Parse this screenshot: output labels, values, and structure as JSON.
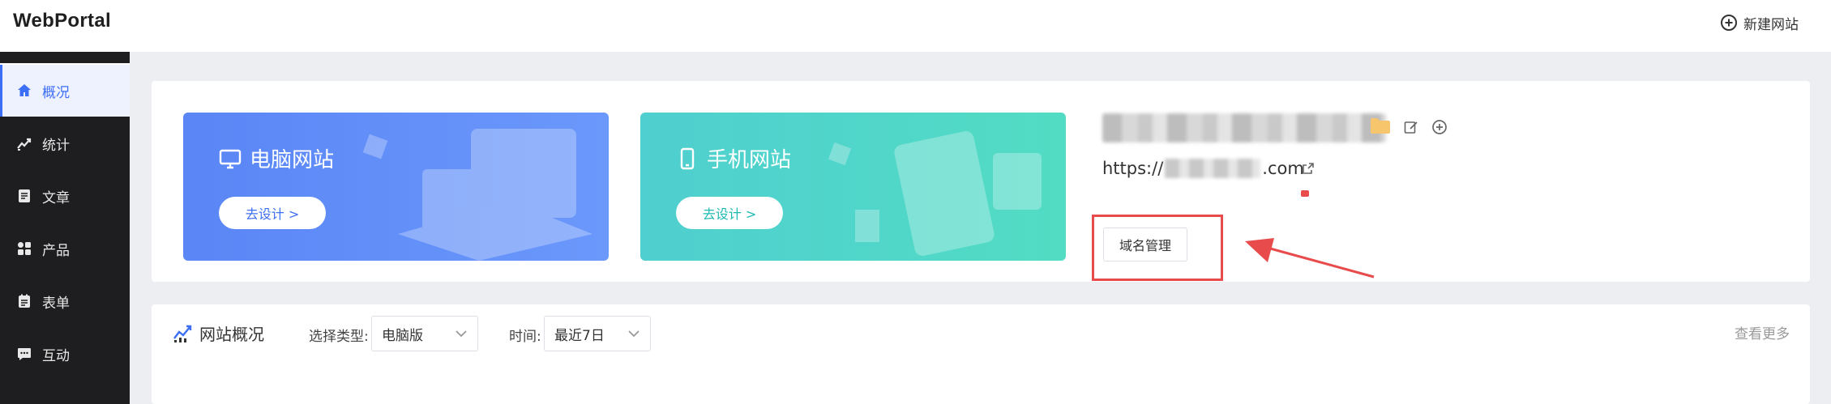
{
  "header": {
    "logo": "WebPortal",
    "new_site_label": "新建网站"
  },
  "sidebar": {
    "items": [
      {
        "label": "概况",
        "icon": "home-icon",
        "active": true
      },
      {
        "label": "统计",
        "icon": "chart-line-icon"
      },
      {
        "label": "文章",
        "icon": "article-icon"
      },
      {
        "label": "产品",
        "icon": "grid-icon"
      },
      {
        "label": "表单",
        "icon": "form-icon"
      },
      {
        "label": "互动",
        "icon": "chat-icon"
      }
    ]
  },
  "cards": {
    "pc": {
      "title": "电脑网站",
      "button": "去设计 >"
    },
    "mobile": {
      "title": "手机网站",
      "button": "去设计 >"
    }
  },
  "site_info": {
    "url_prefix": "https://",
    "url_suffix": ".com",
    "domain_button": "域名管理"
  },
  "overview": {
    "title": "网站概况",
    "type_label": "选择类型:",
    "type_value": "电脑版",
    "time_label": "时间:",
    "time_value": "最近7日",
    "view_more": "查看更多"
  },
  "colors": {
    "accent": "#3d6ef6",
    "pc_card": "#5a86f6",
    "mobile_card": "#4fcfcf",
    "annotation": "#e84b4b",
    "sidebar_bg": "#1e1e20"
  }
}
